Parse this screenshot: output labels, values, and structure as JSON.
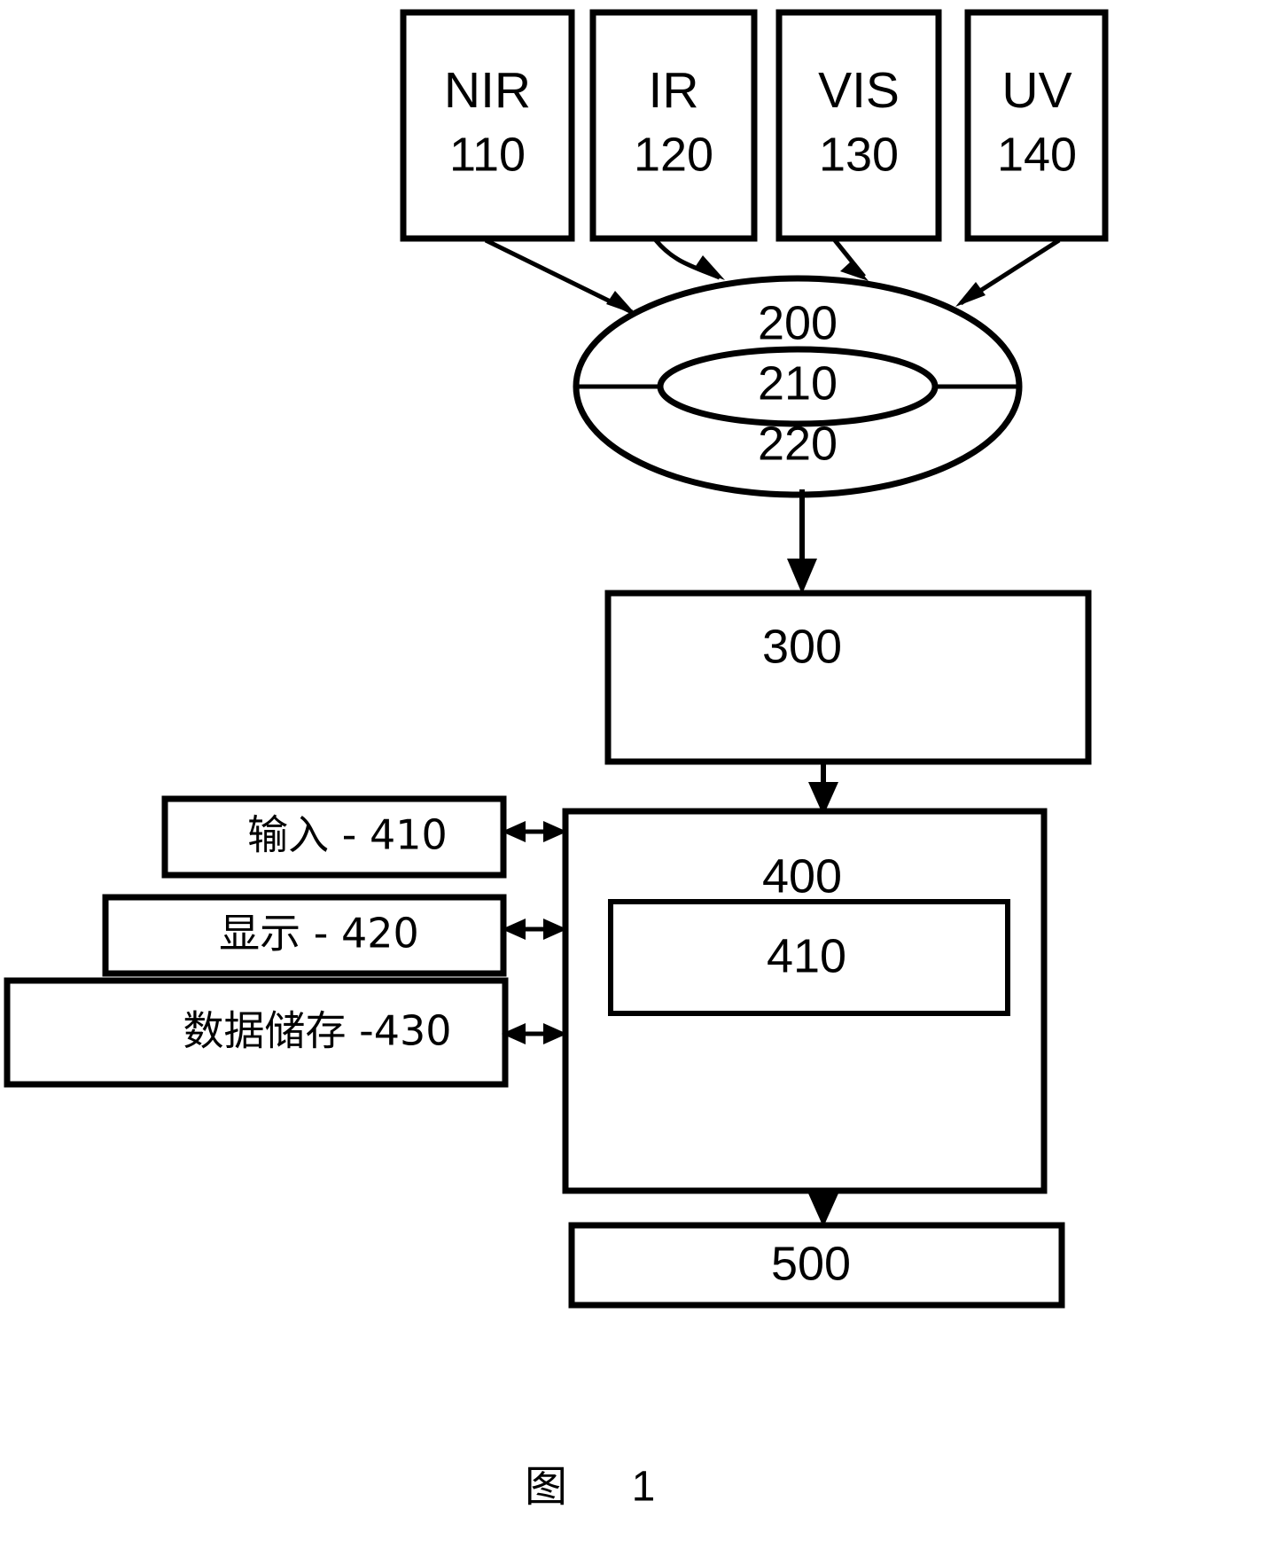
{
  "figure": {
    "caption_label": "图",
    "caption_number": "1"
  },
  "sensors": [
    {
      "name": "NIR",
      "number": "110"
    },
    {
      "name": "IR",
      "number": "120"
    },
    {
      "name": "VIS",
      "number": "130"
    },
    {
      "name": "UV",
      "number": "140"
    }
  ],
  "optics": {
    "outer_label": "200",
    "inner_label": "210",
    "lower_label": "220"
  },
  "processing": {
    "label": "300"
  },
  "computer": {
    "label": "400",
    "inner_label": "410"
  },
  "output": {
    "label": "500"
  },
  "peripherals": [
    {
      "label": "输入 - 410"
    },
    {
      "label": "显示 - 420"
    },
    {
      "label": "数据储存 -430"
    }
  ],
  "colors": {
    "stroke": "#000000",
    "fill": "#ffffff"
  }
}
